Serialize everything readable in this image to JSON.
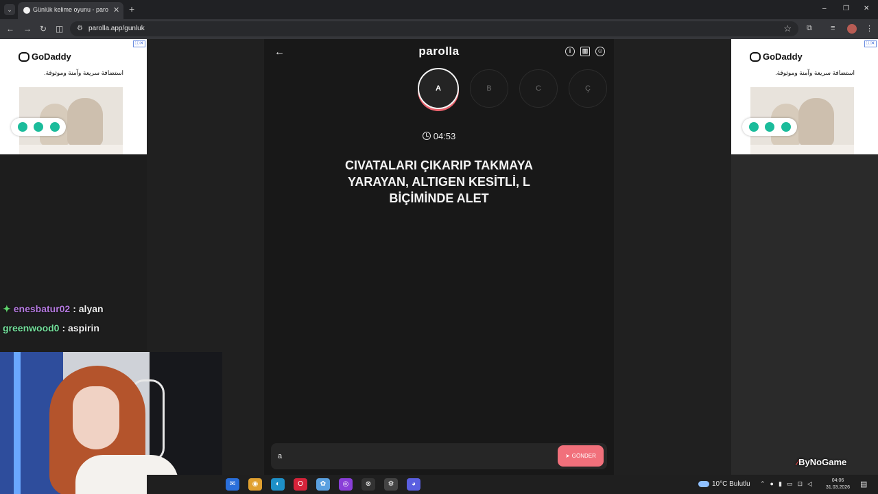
{
  "browser": {
    "tab_title": "Günlük kelime oyunu - parolla",
    "tab_close": "✕",
    "new_tab": "+",
    "url": "parolla.app/gunluk",
    "minimize": "–",
    "maximize": "❐",
    "close": "✕"
  },
  "ads": {
    "brand": "GoDaddy",
    "tagline": "استضافة سريعة وآمنة وموثوقة.",
    "badge": "ⓘ✕"
  },
  "game": {
    "title": "parolla",
    "back_icon": "←",
    "letters": [
      {
        "label": "A",
        "active": true
      },
      {
        "label": "B",
        "active": false
      },
      {
        "label": "C",
        "active": false
      },
      {
        "label": "Ç",
        "active": false
      }
    ],
    "timer": "04:53",
    "question": "CIVATALARI ÇIKARIP TAKMAYA YARAYAN, ALTIGEN KESİTLİ, L BİÇİMİNDE ALET",
    "answer_value": "a",
    "send_label": "GÖNDER",
    "send_icon": "➤",
    "accent_color": "#f1707b"
  },
  "chat": [
    {
      "user": "enesbatur02",
      "message": ": alyan"
    },
    {
      "user": "greenwood0",
      "message": ": aspirin"
    }
  ],
  "overlay_brand": "ByNoGame",
  "taskbar": {
    "weather": "10°C Bulutlu",
    "time": "04:06",
    "date": "31.03.2026"
  }
}
